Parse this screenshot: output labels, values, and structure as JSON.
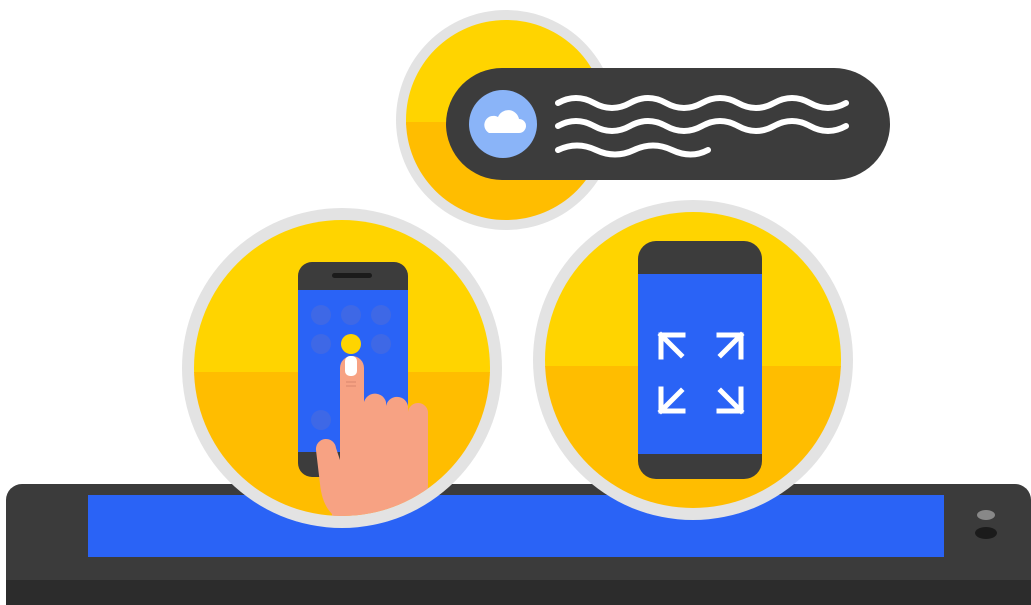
{
  "illustration": {
    "tablet": {
      "screen_color": "#2a63f6",
      "body_color": "#3b3b3b"
    },
    "notification": {
      "icon": "cloud-icon",
      "accent": "#8ab4f8",
      "pill_color": "#3c3c3c"
    },
    "tap_phone": {
      "icon": "tap-gesture-icon",
      "dot_color": "#3e68e6"
    },
    "fullscreen_phone": {
      "icon": "expand-arrows-icon"
    },
    "colors": {
      "yellow": "#ffd400",
      "amber": "#ffbd00",
      "ring": "#e3e3e3",
      "skin": "#f7a283"
    }
  }
}
